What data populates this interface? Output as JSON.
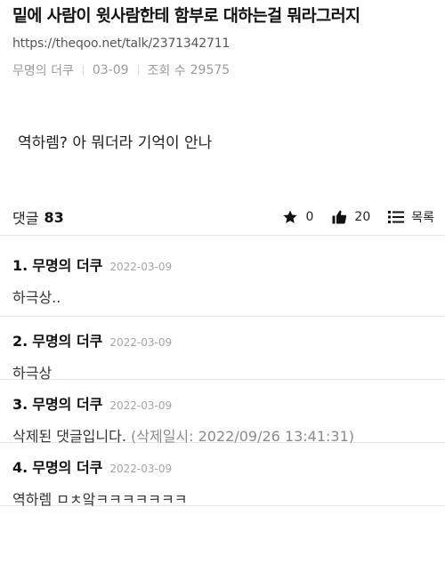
{
  "post": {
    "title": "밑에 사람이 윗사람한테 함부로 대하는걸 뭐라그러지",
    "url": "https://theqoo.net/talk/2371342711",
    "author": "무명의 더쿠",
    "date": "03-09",
    "views_label": "조회 수",
    "views": "29575",
    "body": "역하렘? 아 뭐더라 기억이 안나"
  },
  "actions": {
    "comment_label": "댓글",
    "comment_count": "83",
    "star_count": "0",
    "like_count": "20",
    "list_label": "목록"
  },
  "comments": [
    {
      "index": "1.",
      "author": "무명의 더쿠",
      "date": "2022-03-09",
      "text": "하극상.."
    },
    {
      "index": "2.",
      "author": "무명의 더쿠",
      "date": "2022-03-09",
      "text": "하극상"
    },
    {
      "index": "3.",
      "author": "무명의 더쿠",
      "date": "2022-03-09",
      "text": "삭제된 댓글입니다.",
      "deleted_note": "(삭제일시: 2022/09/26 13:41:31)"
    },
    {
      "index": "4.",
      "author": "무명의 더쿠",
      "date": "2022-03-09",
      "text": "역하렘 ㅁㅊ앜ㅋㅋㅋㅋㅋㅋㅋ"
    }
  ]
}
